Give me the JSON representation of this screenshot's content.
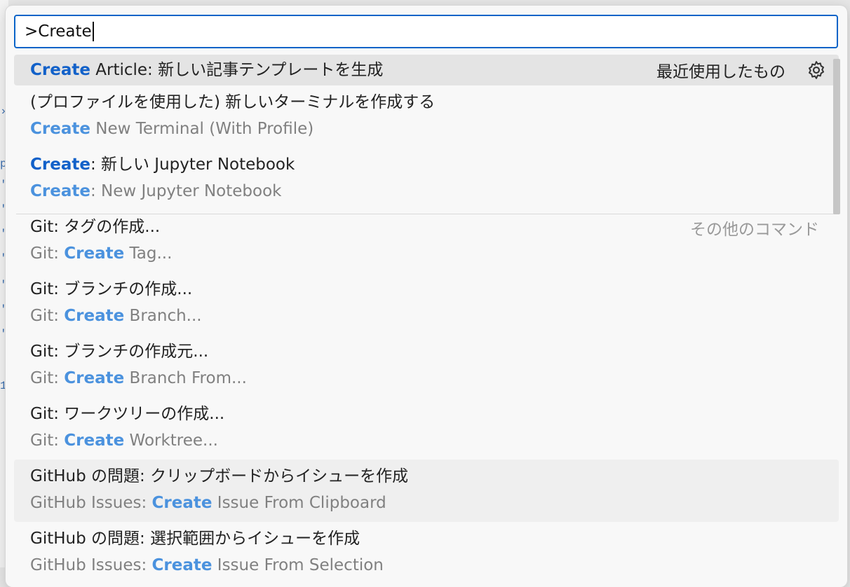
{
  "search": {
    "value": ">Create"
  },
  "items": [
    {
      "highlight": "Create",
      "rest": " Article: 新しい記事テンプレートを生成",
      "recently_used_label": "最近使用したもの",
      "icon": "gear-icon"
    },
    {
      "title": "(プロファイルを使用した) 新しいターミナルを作成する",
      "sub_highlight": "Create",
      "sub_rest": " New Terminal (With Profile)"
    },
    {
      "title_highlight": "Create",
      "title_rest": ": 新しい Jupyter Notebook",
      "sub_highlight": "Create",
      "sub_rest": ": New Jupyter Notebook"
    },
    {
      "title": "Git: タグの作成...",
      "sub_prefix": "Git: ",
      "sub_highlight": "Create",
      "sub_rest": " Tag...",
      "section_label": "その他のコマンド"
    },
    {
      "title": "Git: ブランチの作成...",
      "sub_prefix": "Git: ",
      "sub_highlight": "Create",
      "sub_rest": " Branch..."
    },
    {
      "title": "Git: ブランチの作成元...",
      "sub_prefix": "Git: ",
      "sub_highlight": "Create",
      "sub_rest": " Branch From..."
    },
    {
      "title": "Git: ワークツリーの作成...",
      "sub_prefix": "Git: ",
      "sub_highlight": "Create",
      "sub_rest": " Worktree..."
    },
    {
      "title": "GitHub の問題: クリップボードからイシューを作成",
      "sub_prefix": "GitHub Issues: ",
      "sub_highlight": "Create",
      "sub_rest": " Issue From Clipboard"
    },
    {
      "title": "GitHub の問題: 選択範囲からイシューを作成",
      "sub_prefix": "GitHub Issues: ",
      "sub_highlight": "Create",
      "sub_rest": " Issue From Selection"
    }
  ],
  "colors": {
    "accent": "#1261c9",
    "match_secondary": "#4b92de",
    "focus_border": "#0a64c8"
  }
}
